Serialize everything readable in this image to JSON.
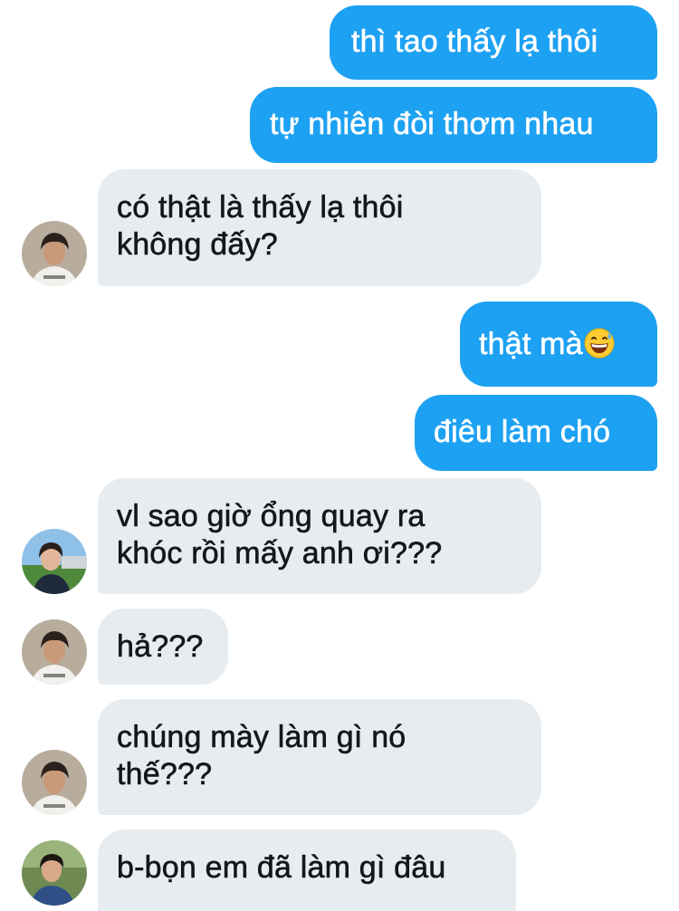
{
  "messages": [
    {
      "side": "sent",
      "text": "thì tao thấy lạ thôi"
    },
    {
      "side": "sent",
      "text": "tự nhiên đòi thơm nhau"
    },
    {
      "side": "received",
      "lines": [
        "có thật là thấy lạ thôi",
        "không đấy?"
      ],
      "avatar": "avatar-white-shirt"
    },
    {
      "side": "sent",
      "text": "thật mà",
      "emoji": "grinning-face-with-sweat-icon"
    },
    {
      "side": "sent",
      "text": "điêu làm chó"
    },
    {
      "side": "received",
      "lines": [
        "vl sao giờ ổng quay ra",
        "khóc rồi mấy anh ơi???"
      ],
      "avatar": "avatar-outdoor"
    },
    {
      "side": "received",
      "lines": [
        "hả???"
      ],
      "avatar": "avatar-white-shirt"
    },
    {
      "side": "received",
      "lines": [
        "chúng mày làm gì nó",
        "thế???"
      ],
      "avatar": "avatar-white-shirt"
    },
    {
      "side": "received",
      "lines": [
        "b-bọn em đã làm gì đâu"
      ],
      "avatar": "avatar-blue-shirt"
    }
  ],
  "colors": {
    "sent_bubble": "#1da1f2",
    "received_bubble": "#e6ecf0",
    "received_text": "#14171a"
  }
}
